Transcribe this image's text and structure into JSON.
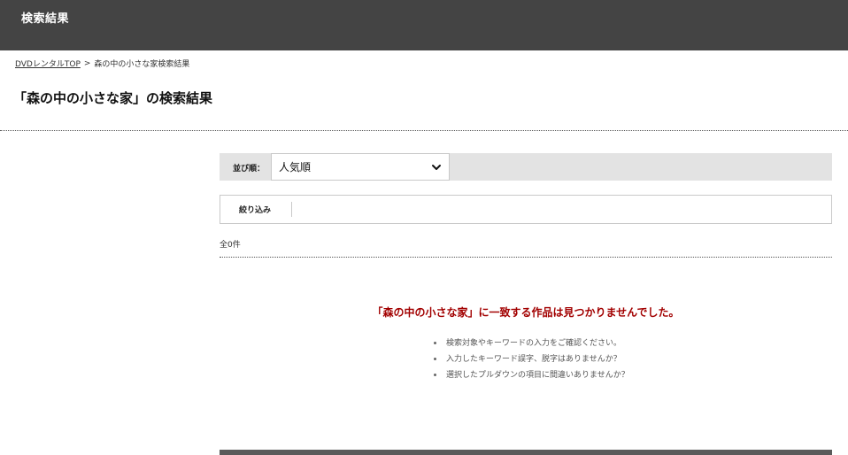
{
  "header": {
    "title": "検索結果"
  },
  "breadcrumb": {
    "home_link": "DVDレンタルTOP",
    "separator": ">",
    "current": "森の中の小さな家検索結果"
  },
  "page": {
    "title": "「森の中の小さな家」の検索結果"
  },
  "sort": {
    "label": "並び順：",
    "selected": "人気順",
    "icon": "chevron-down-icon"
  },
  "filter": {
    "label": "絞り込み"
  },
  "results": {
    "count_text": "全0件"
  },
  "no_results": {
    "message": "「森の中の小さな家」に一致する作品は見つかりませんでした。",
    "tips": [
      "検索対象やキーワードの入力をご確認ください。",
      "入力したキーワード誤字、脱字はありませんか？",
      "選択したプルダウンの項目に間違いありませんか？"
    ]
  },
  "colors": {
    "header_bg": "#444444",
    "accent_red": "#a20000",
    "sortbar_bg": "#e3e3e3"
  }
}
